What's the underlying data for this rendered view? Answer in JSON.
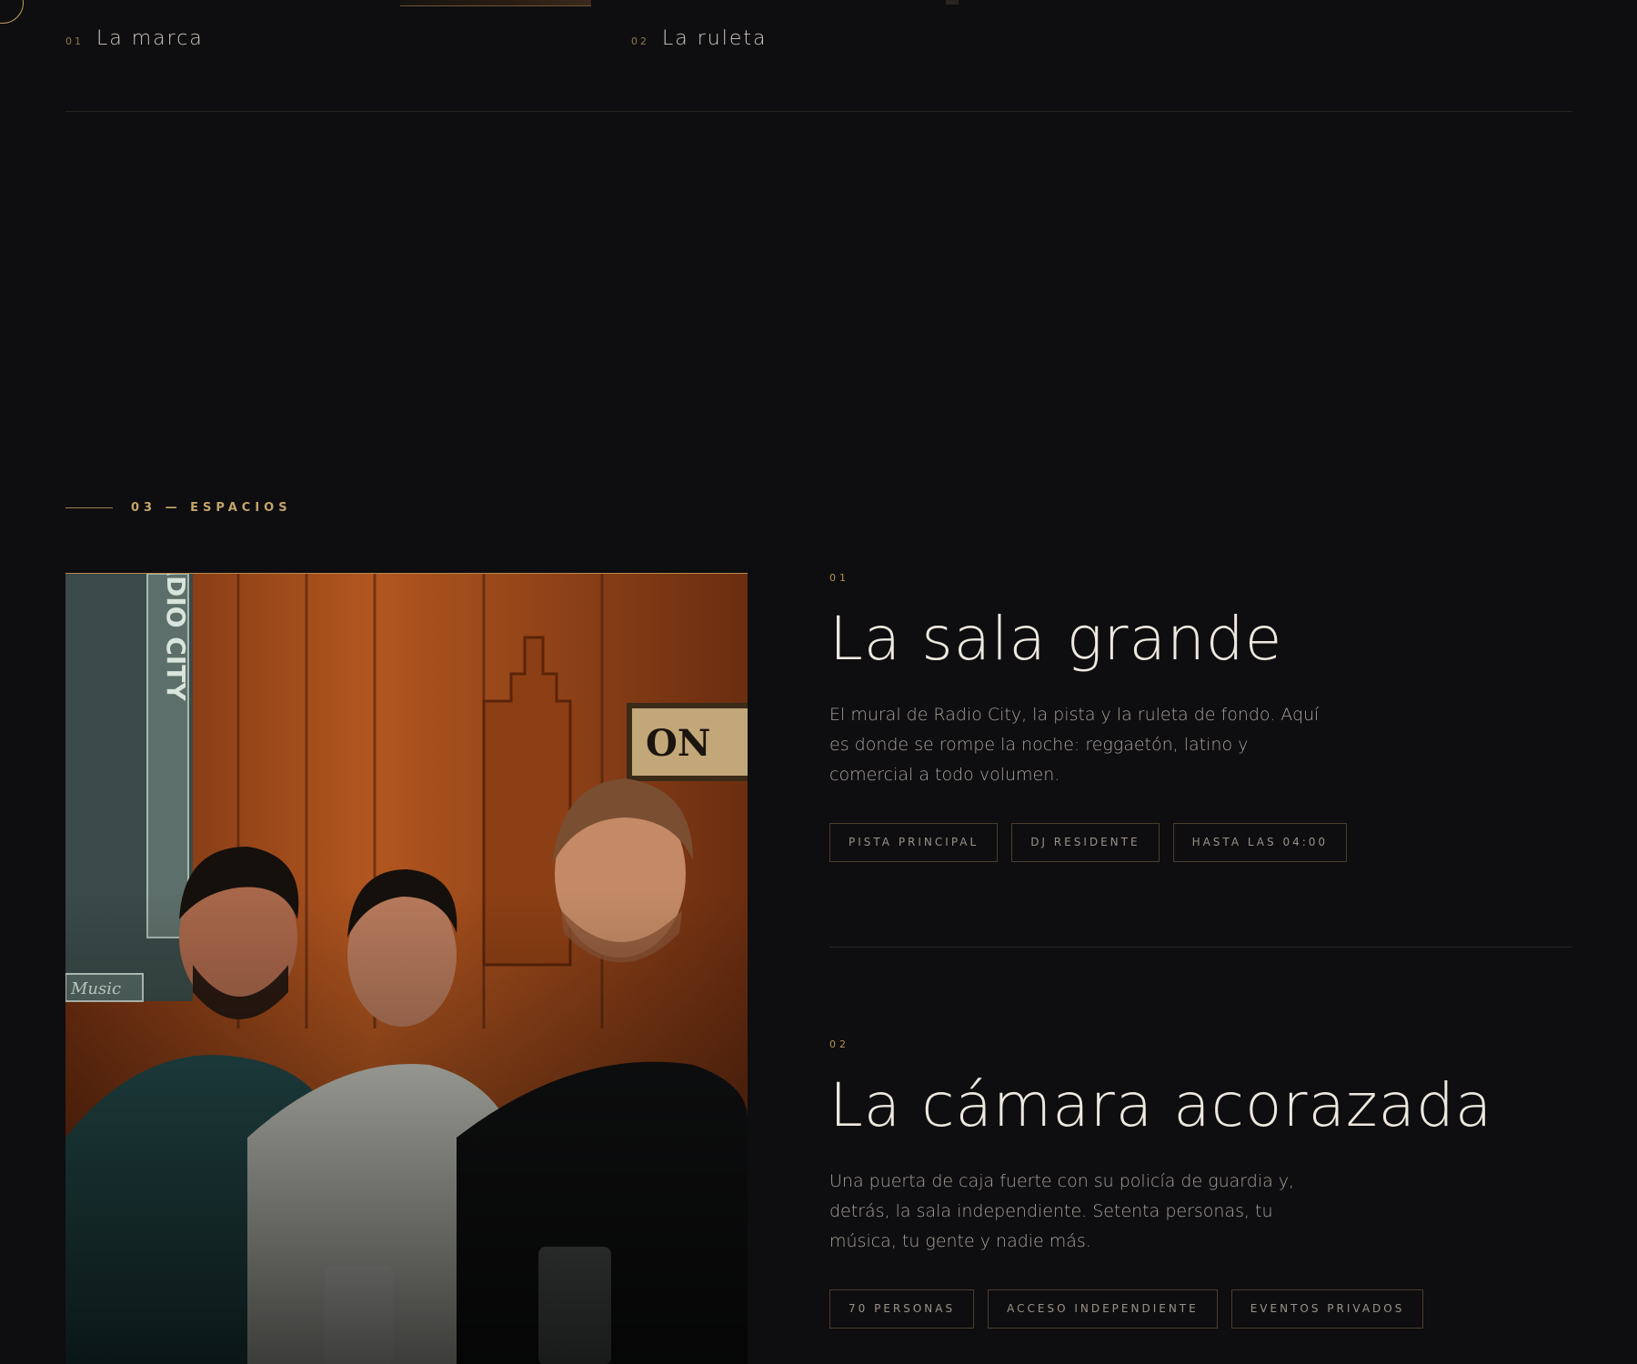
{
  "tabs": [
    {
      "num": "01",
      "label": "La marca"
    },
    {
      "num": "02",
      "label": "La ruleta"
    }
  ],
  "section": {
    "label": "03 — ESPACIOS"
  },
  "photo": {
    "alt": "Tres hombres sonriendo frente al mural de Radio City Music Hall"
  },
  "spaces": [
    {
      "num": "01",
      "title": "La sala grande",
      "description": "El mural de Radio City, la pista y la ruleta de fondo. Aquí es donde se rompe la noche: reggaetón, latino y comercial a todo volumen.",
      "tags": [
        "PISTA PRINCIPAL",
        "DJ RESIDENTE",
        "HASTA LAS 04:00"
      ]
    },
    {
      "num": "02",
      "title": "La cámara acorazada",
      "description": "Una puerta de caja fuerte con su policía de guardia y, detrás, la sala independiente. Setenta personas, tu música, tu gente y nadie más.",
      "tags": [
        "70 PERSONAS",
        "ACCESO INDEPENDIENTE",
        "EVENTOS PRIVADOS"
      ]
    }
  ],
  "colors": {
    "background": "#0e0d10",
    "accent": "#c4a56a",
    "text": "#eee9df"
  }
}
